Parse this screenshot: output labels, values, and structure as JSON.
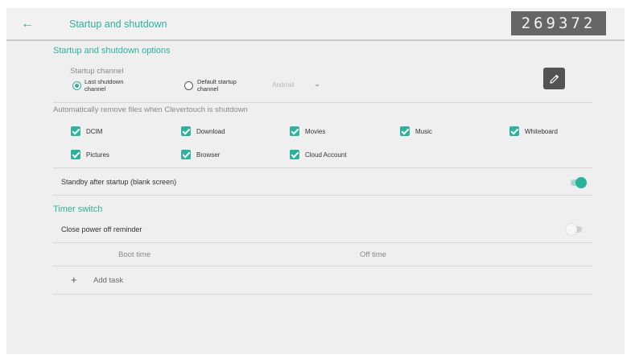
{
  "header": {
    "title": "Startup and shutdown",
    "code": "269372"
  },
  "startup_options": {
    "section_title": "Startup and shutdown options",
    "startup_channel_label": "Startup channel",
    "radios": [
      {
        "label_line1": "Last shutdown",
        "label_line2": "channel",
        "selected": true
      },
      {
        "label_line1": "Default startup",
        "label_line2": "channel",
        "selected": false
      }
    ],
    "dropdown_value": "Android"
  },
  "auto_remove": {
    "label": "Automatically remove files when Clevertouch is shutdown",
    "items": [
      {
        "label": "DCIM",
        "checked": true
      },
      {
        "label": "Download",
        "checked": true
      },
      {
        "label": "Movies",
        "checked": true
      },
      {
        "label": "Music",
        "checked": true
      },
      {
        "label": "Whiteboard",
        "checked": true
      },
      {
        "label": "Pictures",
        "checked": true
      },
      {
        "label": "Browser",
        "checked": true
      },
      {
        "label": "Cloud Account",
        "checked": true
      }
    ]
  },
  "standby": {
    "label": "Standby after startup (blank screen)",
    "enabled": true
  },
  "timer_switch": {
    "section_title": "Timer switch",
    "reminder_label": "Close power off reminder",
    "reminder_enabled": false,
    "boot_time_label": "Boot time",
    "off_time_label": "Off time",
    "add_task_label": "Add task"
  },
  "colors": {
    "accent": "#2bb39b",
    "background": "#efefef",
    "code_box": "#666666"
  }
}
